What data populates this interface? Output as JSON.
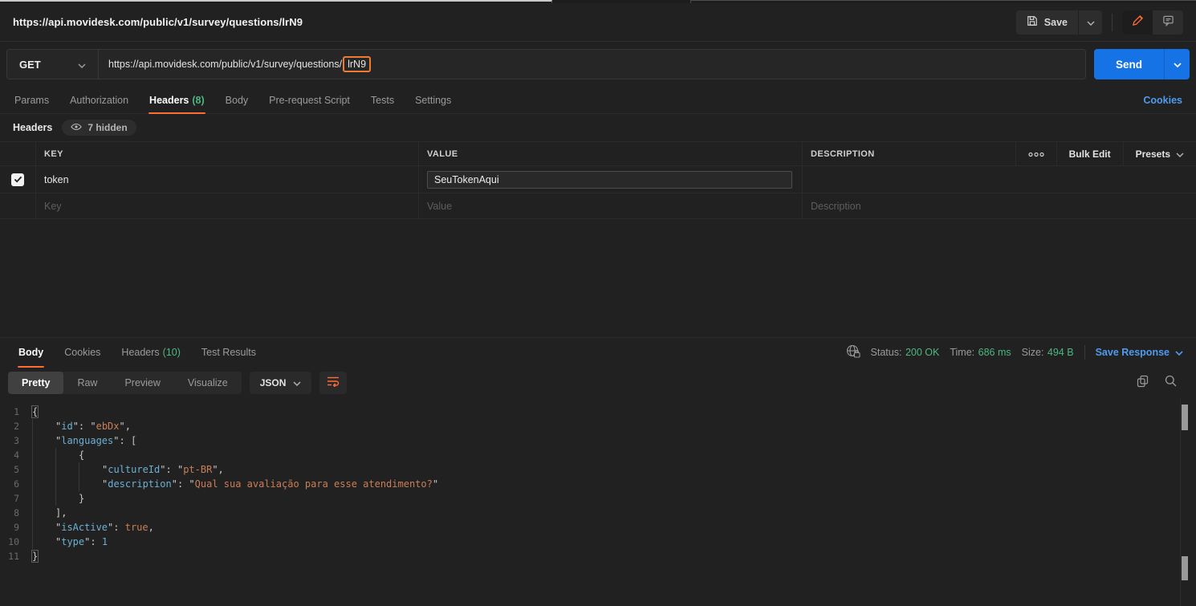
{
  "window": {
    "title": "https://api.movidesk.com/public/v1/survey/questions/lrN9"
  },
  "topbar": {
    "save_label": "Save"
  },
  "request": {
    "method": "GET",
    "url_prefix": "https://api.movidesk.com/public/v1/survey/questions/",
    "url_highlight": "lrN9",
    "send_label": "Send",
    "cookies_link": "Cookies",
    "tabs": [
      {
        "label": "Params"
      },
      {
        "label": "Authorization"
      },
      {
        "label": "Headers",
        "count": "(8)",
        "active": true
      },
      {
        "label": "Body"
      },
      {
        "label": "Pre-request Script"
      },
      {
        "label": "Tests"
      },
      {
        "label": "Settings"
      }
    ]
  },
  "headers_editor": {
    "section_label": "Headers",
    "hidden_badge": "7 hidden",
    "columns": {
      "key": "KEY",
      "value": "VALUE",
      "description": "DESCRIPTION"
    },
    "bulk_edit_label": "Bulk Edit",
    "presets_label": "Presets",
    "rows": [
      {
        "checked": true,
        "key": "token",
        "value": "SeuTokenAqui",
        "description": ""
      }
    ],
    "placeholder_row": {
      "key": "Key",
      "value": "Value",
      "description": "Description"
    }
  },
  "response": {
    "tabs": [
      {
        "label": "Body",
        "active": true
      },
      {
        "label": "Cookies"
      },
      {
        "label": "Headers",
        "count": "(10)"
      },
      {
        "label": "Test Results"
      }
    ],
    "status_label": "Status:",
    "status_value": "200 OK",
    "time_label": "Time:",
    "time_value": "686 ms",
    "size_label": "Size:",
    "size_value": "494 B",
    "save_response_label": "Save Response",
    "view_tabs": [
      {
        "label": "Pretty",
        "active": true
      },
      {
        "label": "Raw"
      },
      {
        "label": "Preview"
      },
      {
        "label": "Visualize"
      }
    ],
    "format": "JSON",
    "body": {
      "id": "ebDx",
      "languages": [
        {
          "cultureId": "pt-BR",
          "description": "Qual sua avaliação para esse atendimento?"
        }
      ],
      "isActive": true,
      "type": 1
    },
    "code_lines": [
      {
        "n": "1",
        "ind": 0,
        "tokens": [
          {
            "t": "{",
            "c": "p hl"
          }
        ]
      },
      {
        "n": "2",
        "ind": 1,
        "tokens": [
          {
            "t": "\"",
            "c": "q"
          },
          {
            "t": "id",
            "c": "k"
          },
          {
            "t": "\"",
            "c": "q"
          },
          {
            "t": ": ",
            "c": "p"
          },
          {
            "t": "\"",
            "c": "q"
          },
          {
            "t": "ebDx",
            "c": "s"
          },
          {
            "t": "\"",
            "c": "q"
          },
          {
            "t": ",",
            "c": "p"
          }
        ]
      },
      {
        "n": "3",
        "ind": 1,
        "tokens": [
          {
            "t": "\"",
            "c": "q"
          },
          {
            "t": "languages",
            "c": "k"
          },
          {
            "t": "\"",
            "c": "q"
          },
          {
            "t": ": [",
            "c": "p"
          }
        ]
      },
      {
        "n": "4",
        "ind": 2,
        "tokens": [
          {
            "t": "{",
            "c": "p"
          }
        ]
      },
      {
        "n": "5",
        "ind": 3,
        "tokens": [
          {
            "t": "\"",
            "c": "q"
          },
          {
            "t": "cultureId",
            "c": "k"
          },
          {
            "t": "\"",
            "c": "q"
          },
          {
            "t": ": ",
            "c": "p"
          },
          {
            "t": "\"",
            "c": "q"
          },
          {
            "t": "pt-BR",
            "c": "s"
          },
          {
            "t": "\"",
            "c": "q"
          },
          {
            "t": ",",
            "c": "p"
          }
        ]
      },
      {
        "n": "6",
        "ind": 3,
        "tokens": [
          {
            "t": "\"",
            "c": "q"
          },
          {
            "t": "description",
            "c": "k"
          },
          {
            "t": "\"",
            "c": "q"
          },
          {
            "t": ": ",
            "c": "p"
          },
          {
            "t": "\"",
            "c": "q"
          },
          {
            "t": "Qual sua avaliação para esse atendimento?",
            "c": "s"
          },
          {
            "t": "\"",
            "c": "q"
          }
        ]
      },
      {
        "n": "7",
        "ind": 2,
        "tokens": [
          {
            "t": "}",
            "c": "p"
          }
        ]
      },
      {
        "n": "8",
        "ind": 1,
        "tokens": [
          {
            "t": "],",
            "c": "p"
          }
        ]
      },
      {
        "n": "9",
        "ind": 1,
        "tokens": [
          {
            "t": "\"",
            "c": "q"
          },
          {
            "t": "isActive",
            "c": "k"
          },
          {
            "t": "\"",
            "c": "q"
          },
          {
            "t": ": ",
            "c": "p"
          },
          {
            "t": "true",
            "c": "b"
          },
          {
            "t": ",",
            "c": "p"
          }
        ]
      },
      {
        "n": "10",
        "ind": 1,
        "tokens": [
          {
            "t": "\"",
            "c": "q"
          },
          {
            "t": "type",
            "c": "k"
          },
          {
            "t": "\"",
            "c": "q"
          },
          {
            "t": ": ",
            "c": "p"
          },
          {
            "t": "1",
            "c": "num"
          }
        ]
      },
      {
        "n": "11",
        "ind": 0,
        "tokens": [
          {
            "t": "}",
            "c": "p hl"
          }
        ]
      }
    ]
  },
  "colors": {
    "accent_orange": "#ff6c37",
    "annotation_orange": "#ee7b30",
    "green": "#4cb782",
    "link_blue": "#4e9bef",
    "send_blue": "#1673e6",
    "json_key_blue": "#6cb0d4",
    "json_string_orange": "#c97e57",
    "background": "#212121"
  }
}
